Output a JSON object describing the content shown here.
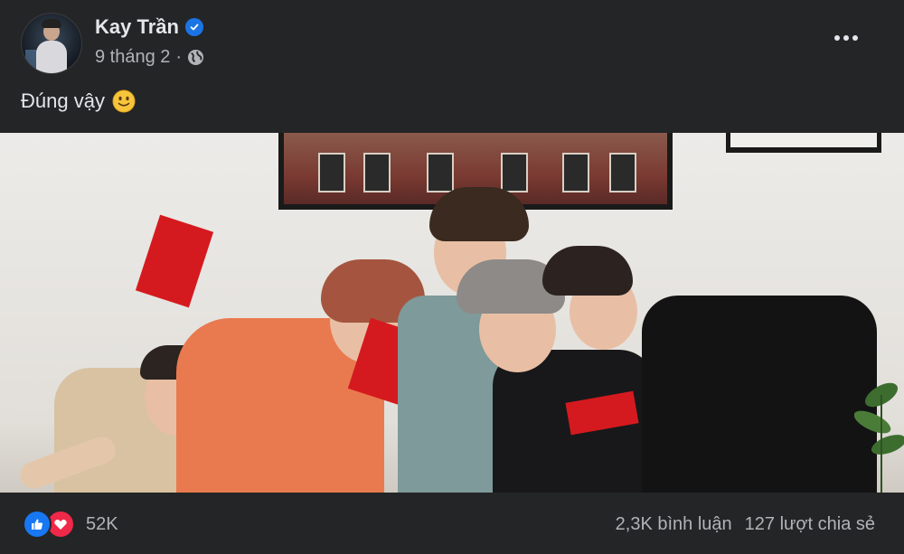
{
  "post": {
    "author": "Kay Trần",
    "verified_icon": "verified-badge-icon",
    "date": "9 tháng 2",
    "separator": "·",
    "privacy_icon": "globe-icon",
    "more_icon": "more-options-icon",
    "text": "Đúng vậy",
    "emoji": "slightly-smiling-face-icon"
  },
  "photo": {
    "description_icon": "post-photo"
  },
  "footer": {
    "reaction_icons": [
      "like-icon",
      "love-icon"
    ],
    "reaction_count": "52K",
    "comments": "2,3K bình luận",
    "shares": "127 lượt chia sẻ"
  },
  "colors": {
    "background": "#242526",
    "text_primary": "#e4e6eb",
    "text_secondary": "#b0b3b8",
    "verified": "#1b74e4",
    "like": "#1877f2",
    "love": "#f02849"
  }
}
